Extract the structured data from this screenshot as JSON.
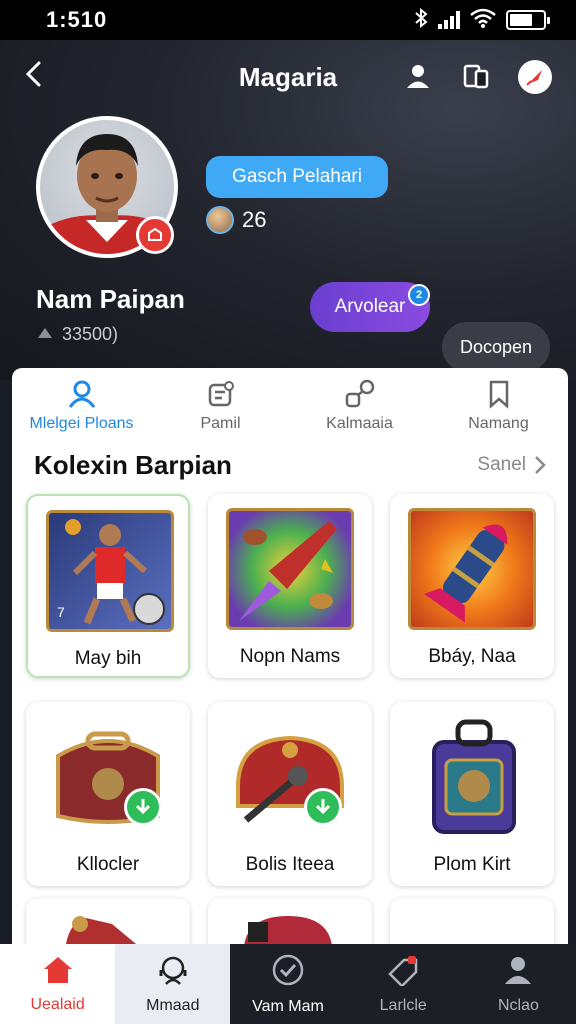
{
  "status_bar": {
    "time": "1:510"
  },
  "header": {
    "title": "Magaria"
  },
  "profile": {
    "search_button": "Gasch Pelahari",
    "rank_value": "26",
    "name": "Nam Paipan",
    "sub_text": "33500)",
    "primary_button": "Arvolear",
    "primary_badge": "2",
    "secondary_button": "Docopen"
  },
  "tabs": [
    {
      "label": "Mlelgei Ploans",
      "icon": "user-icon"
    },
    {
      "label": "Pamil",
      "icon": "badge-icon"
    },
    {
      "label": "Kalmaaia",
      "icon": "share-icon"
    },
    {
      "label": "Namang",
      "icon": "bookmark-icon"
    }
  ],
  "collection": {
    "title": "Kolexin Barpian",
    "see_all": "Sanel",
    "items": [
      {
        "label": "May bih"
      },
      {
        "label": "Nopn Nams"
      },
      {
        "label": "Bbáy, Naa"
      },
      {
        "label": "Kllocler"
      },
      {
        "label": "Bolis Iteea"
      },
      {
        "label": "Plom Kirt"
      }
    ]
  },
  "bottom_nav": [
    {
      "label": "Uealaid",
      "icon": "home-icon"
    },
    {
      "label": "Mmaad",
      "icon": "support-icon"
    },
    {
      "label": "Vam Mam",
      "icon": "check-icon"
    },
    {
      "label": "Larlcle",
      "icon": "tag-icon"
    },
    {
      "label": "Nclao",
      "icon": "profile-icon"
    }
  ],
  "colors": {
    "accent": "#1e88e5",
    "primary_button": "#7a45d8",
    "home_active": "#e53935",
    "download_badge": "#2ebd59"
  }
}
